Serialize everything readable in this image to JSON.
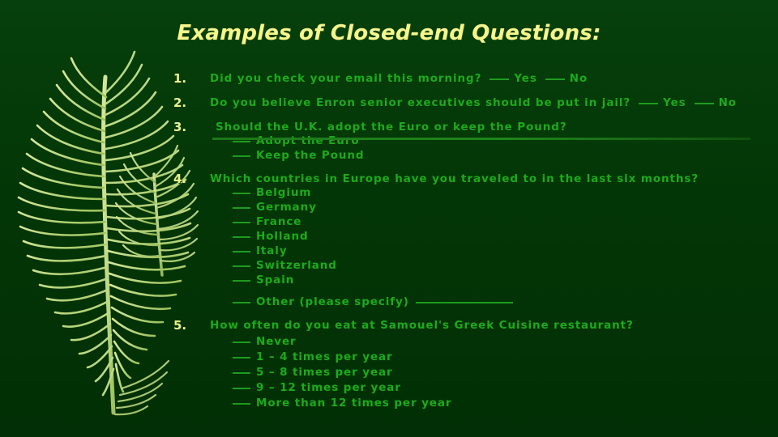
{
  "slide": {
    "title": "Examples of Closed-end Questions:",
    "background_color": "#03350a",
    "text_color": "#1bab1b",
    "number_color": "#e9f28d",
    "title_color": "#f6f68c",
    "decoration": "feather-plume-graphic"
  },
  "questions": [
    {
      "number": "1.",
      "text": "Did you check your email this morning?",
      "inline_options": [
        "Yes",
        "No"
      ],
      "options": []
    },
    {
      "number": "2.",
      "text": "Do you believe Enron senior executives should be put in jail?",
      "inline_options": [
        "Yes",
        "No"
      ],
      "options": []
    },
    {
      "number": "3.",
      "text": "Should the U.K. adopt the Euro or keep the Pound?",
      "inline_options": [],
      "options": [
        "Adopt the Euro",
        "Keep the Pound"
      ]
    },
    {
      "number": "4.",
      "text": "Which countries in Europe have you traveled to in the last six months?",
      "inline_options": [],
      "options": [
        "Belgium",
        "Germany",
        "France",
        "Holland",
        "Italy",
        "Switzerland",
        "Spain"
      ],
      "other_option": "Other (please specify)"
    },
    {
      "number": "5.",
      "text": "How often do you eat at Samouel's Greek Cuisine restaurant?",
      "inline_options": [],
      "options": [
        "Never",
        "1 – 4 times per year",
        "5 – 8 times per year",
        "9 – 12 times per year",
        "More than 12 times per year"
      ]
    }
  ]
}
